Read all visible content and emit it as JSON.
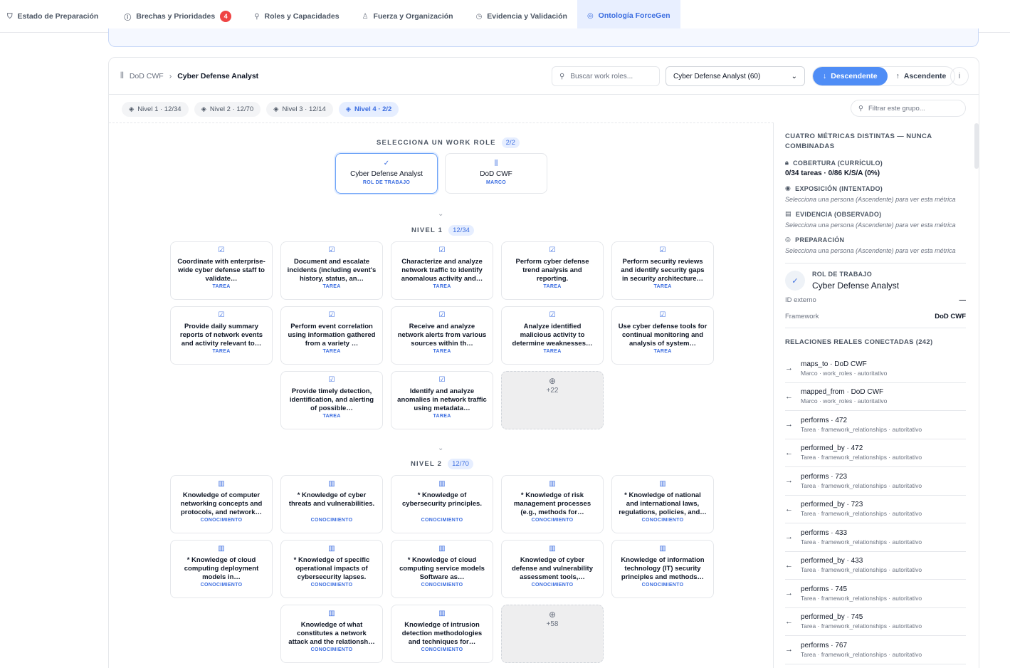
{
  "tabs": [
    {
      "label": "Estado de Preparación",
      "icon": "shield-icon"
    },
    {
      "label": "Brechas y Prioridades",
      "icon": "alert-circle-icon",
      "badge": "4"
    },
    {
      "label": "Roles y Capacidades",
      "icon": "org-chart-icon"
    },
    {
      "label": "Fuerza y Organización",
      "icon": "user-icon"
    },
    {
      "label": "Evidencia y Validación",
      "icon": "clock-icon"
    },
    {
      "label": "Ontología ForceGen",
      "icon": "globe-icon",
      "active": true
    }
  ],
  "header": {
    "breadcrumb_root": "DoD CWF",
    "breadcrumb_current": "Cyber Defense Analyst",
    "search_placeholder": "Buscar work roles...",
    "select_value": "Cyber Defense Analyst (60)",
    "btn_descendente": "Descendente",
    "btn_ascendente": "Ascendente"
  },
  "levels": [
    {
      "label": "Nivel 1 · 12/34",
      "active": false
    },
    {
      "label": "Nivel 2 · 12/70",
      "active": false
    },
    {
      "label": "Nivel 3 · 12/14",
      "active": false
    },
    {
      "label": "Nivel 4 · 2/2",
      "active": true
    }
  ],
  "filter_placeholder": "Filtrar este grupo...",
  "selector": {
    "title": "SELECCIONA UN WORK ROLE",
    "count": "2/2",
    "roles": [
      {
        "name": "Cyber Defense Analyst",
        "type": "ROL DE TRABAJO",
        "selected": true
      },
      {
        "name": "DoD CWF",
        "type": "MARCO",
        "selected": false
      }
    ]
  },
  "nivel1": {
    "title": "NIVEL 1",
    "count": "12/34",
    "cards": [
      {
        "text": "Coordinate with enterprise-wide cyber defense staff to validate…",
        "type": "TAREA"
      },
      {
        "text": "Document and escalate incidents (including event's history, status, an…",
        "type": "TAREA"
      },
      {
        "text": "Characterize and analyze network traffic to identify anomalous activity and…",
        "type": "TAREA"
      },
      {
        "text": "Perform cyber defense trend analysis and reporting.",
        "type": "TAREA"
      },
      {
        "text": "Perform security reviews and identify security gaps in security architecture…",
        "type": "TAREA"
      },
      {
        "text": "Provide daily summary reports of network events and activity relevant to…",
        "type": "TAREA"
      },
      {
        "text": "Perform event correlation using information gathered from a variety …",
        "type": "TAREA"
      },
      {
        "text": "Receive and analyze network alerts from various sources within th…",
        "type": "TAREA"
      },
      {
        "text": "Analyze identified malicious activity to determine weaknesses…",
        "type": "TAREA"
      },
      {
        "text": "Use cyber defense tools for continual monitoring and analysis of system…",
        "type": "TAREA"
      },
      {
        "text": "Provide timely detection, identification, and alerting of possible…",
        "type": "TAREA"
      },
      {
        "text": "Identify and analyze anomalies in network traffic using metadata…",
        "type": "TAREA"
      }
    ],
    "more": "+22"
  },
  "nivel2": {
    "title": "NIVEL 2",
    "count": "12/70",
    "cards": [
      {
        "text": "Knowledge of computer networking concepts and protocols, and network…",
        "type": "CONOCIMIENTO"
      },
      {
        "text": "* Knowledge of cyber threats and vulnerabilities.",
        "type": "CONOCIMIENTO"
      },
      {
        "text": "* Knowledge of cybersecurity principles.",
        "type": "CONOCIMIENTO"
      },
      {
        "text": "* Knowledge of risk management processes (e.g., methods for…",
        "type": "CONOCIMIENTO"
      },
      {
        "text": "* Knowledge of national and international laws, regulations, policies, and…",
        "type": "CONOCIMIENTO"
      },
      {
        "text": "* Knowledge of cloud computing deployment models in…",
        "type": "CONOCIMIENTO"
      },
      {
        "text": "* Knowledge of specific operational impacts of cybersecurity lapses.",
        "type": "CONOCIMIENTO"
      },
      {
        "text": "* Knowledge of cloud computing service models Software as…",
        "type": "CONOCIMIENTO"
      },
      {
        "text": "Knowledge of cyber defense and vulnerability assessment tools,…",
        "type": "CONOCIMIENTO"
      },
      {
        "text": "Knowledge of information technology (IT) security principles and methods…",
        "type": "CONOCIMIENTO"
      },
      {
        "text": "Knowledge of what constitutes a network attack and the relationsh…",
        "type": "CONOCIMIENTO"
      },
      {
        "text": "Knowledge of intrusion detection methodologies and techniques for…",
        "type": "CONOCIMIENTO"
      }
    ],
    "more": "+58"
  },
  "sidebar": {
    "heading": "CUATRO MÉTRICAS DISTINTAS — NUNCA COMBINADAS",
    "metrics": [
      {
        "label": "COBERTURA (CURRÍCULO)",
        "value": "0/34 tareas · 0/86 K/S/A (0%)"
      },
      {
        "label": "EXPOSICIÓN (INTENTADO)",
        "note": "Selecciona una persona (Ascendente) para ver esta métrica"
      },
      {
        "label": "EVIDENCIA (OBSERVADO)",
        "note": "Selecciona una persona (Ascendente) para ver esta métrica"
      },
      {
        "label": "PREPARACIÓN",
        "note": "Selecciona una persona (Ascendente) para ver esta métrica"
      }
    ],
    "role_label": "ROL DE TRABAJO",
    "role_name": "Cyber Defense Analyst",
    "external_id_label": "ID externo",
    "external_id_value": "—",
    "framework_label": "Framework",
    "framework_value": "DoD CWF",
    "relations_heading": "RELACIONES REALES CONECTADAS (242)",
    "relations": [
      {
        "dir": "out",
        "title": "maps_to · DoD CWF",
        "sub": "Marco · work_roles · autoritativo"
      },
      {
        "dir": "in",
        "title": "mapped_from · DoD CWF",
        "sub": "Marco · work_roles · autoritativo"
      },
      {
        "dir": "out",
        "title": "performs · 472",
        "sub": "Tarea · framework_relationships · autoritativo"
      },
      {
        "dir": "in",
        "title": "performed_by · 472",
        "sub": "Tarea · framework_relationships · autoritativo"
      },
      {
        "dir": "out",
        "title": "performs · 723",
        "sub": "Tarea · framework_relationships · autoritativo"
      },
      {
        "dir": "in",
        "title": "performed_by · 723",
        "sub": "Tarea · framework_relationships · autoritativo"
      },
      {
        "dir": "out",
        "title": "performs · 433",
        "sub": "Tarea · framework_relationships · autoritativo"
      },
      {
        "dir": "in",
        "title": "performed_by · 433",
        "sub": "Tarea · framework_relationships · autoritativo"
      },
      {
        "dir": "out",
        "title": "performs · 745",
        "sub": "Tarea · framework_relationships · autoritativo"
      },
      {
        "dir": "in",
        "title": "performed_by · 745",
        "sub": "Tarea · framework_relationships · autoritativo"
      },
      {
        "dir": "out",
        "title": "performs · 767",
        "sub": "Tarea · framework_relationships · autoritativo"
      }
    ]
  }
}
